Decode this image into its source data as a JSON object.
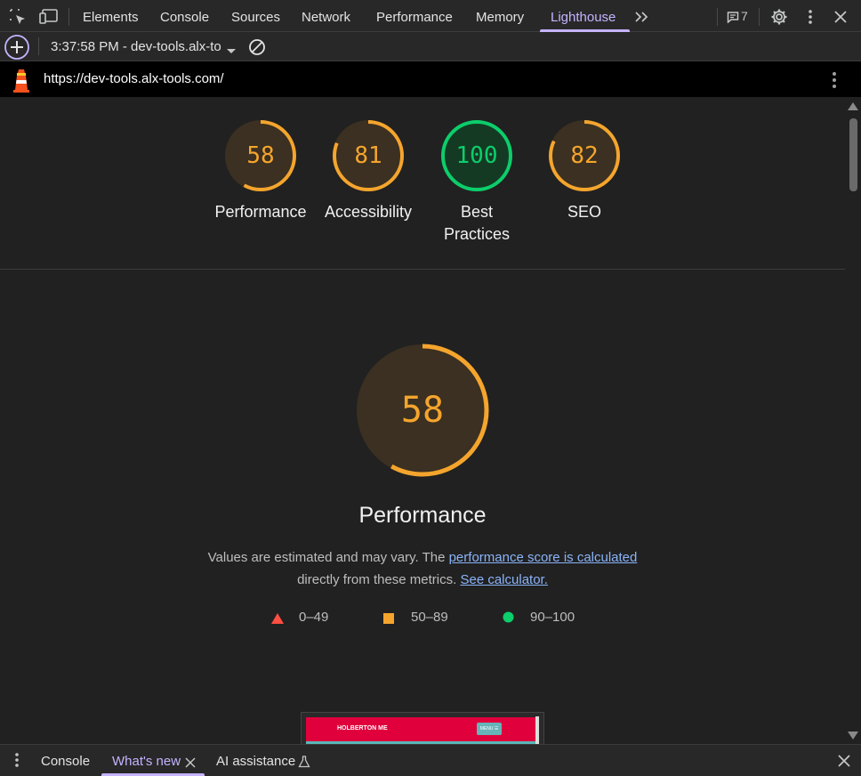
{
  "colors": {
    "accent": "#c5b3ff",
    "average": "#f5a52d",
    "pass": "#0cce6b",
    "fail": "#ff4e42",
    "link": "#8ab4f8"
  },
  "toolbar": {
    "tabs": [
      "Elements",
      "Console",
      "Sources",
      "Network",
      "Performance",
      "Memory",
      "Lighthouse"
    ],
    "active_tab": "Lighthouse",
    "issues_count": "7",
    "icons": [
      "inspect-element-icon",
      "device-toolbar-icon",
      "more-tabs-icon",
      "issues-icon",
      "settings-icon",
      "more-options-icon",
      "close-icon"
    ]
  },
  "report_toolbar": {
    "report_selector": "3:37:58 PM - dev-tools.alx-to",
    "icons": [
      "new-report-icon",
      "dropdown-arrow-icon",
      "clear-icon"
    ]
  },
  "url_bar": {
    "url": "https://dev-tools.alx-tools.com/",
    "icons": [
      "lighthouse-icon",
      "more-vert-icon"
    ]
  },
  "scores": [
    {
      "label": "Performance",
      "value": "58",
      "status": "average"
    },
    {
      "label": "Accessibility",
      "value": "81",
      "status": "average"
    },
    {
      "label": "Best Practices",
      "line1": "Best",
      "line2": "Practices",
      "value": "100",
      "status": "pass"
    },
    {
      "label": "SEO",
      "value": "82",
      "status": "average"
    }
  ],
  "performance": {
    "score": "58",
    "title": "Performance",
    "desc_text1": "Values are estimated and may vary. The ",
    "desc_link1": "performance score is calculated",
    "desc_text2": "directly from these metrics. ",
    "desc_link2": "See calculator."
  },
  "legend": [
    {
      "range": "0–49",
      "shape": "triangle"
    },
    {
      "range": "50–89",
      "shape": "square"
    },
    {
      "range": "90–100",
      "shape": "circle"
    }
  ],
  "screenshot_thumb": {
    "title": "HOLBERTON ME",
    "button": "MENU ☰"
  },
  "drawer": {
    "tabs": [
      "Console",
      "What's new",
      "AI assistance"
    ],
    "active_tab": "What's new"
  }
}
